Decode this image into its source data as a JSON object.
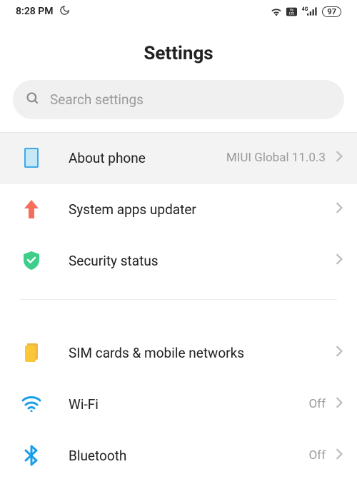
{
  "status_bar": {
    "time": "8:28 PM",
    "signal_label": "4G",
    "battery": "97"
  },
  "header": {
    "title": "Settings"
  },
  "search": {
    "placeholder": "Search settings"
  },
  "items": {
    "about_phone": {
      "label": "About phone",
      "value": "MIUI Global 11.0.3"
    },
    "system_apps_updater": {
      "label": "System apps updater"
    },
    "security_status": {
      "label": "Security status"
    },
    "sim_cards": {
      "label": "SIM cards & mobile networks"
    },
    "wifi": {
      "label": "Wi-Fi",
      "value": "Off"
    },
    "bluetooth": {
      "label": "Bluetooth",
      "value": "Off"
    }
  }
}
